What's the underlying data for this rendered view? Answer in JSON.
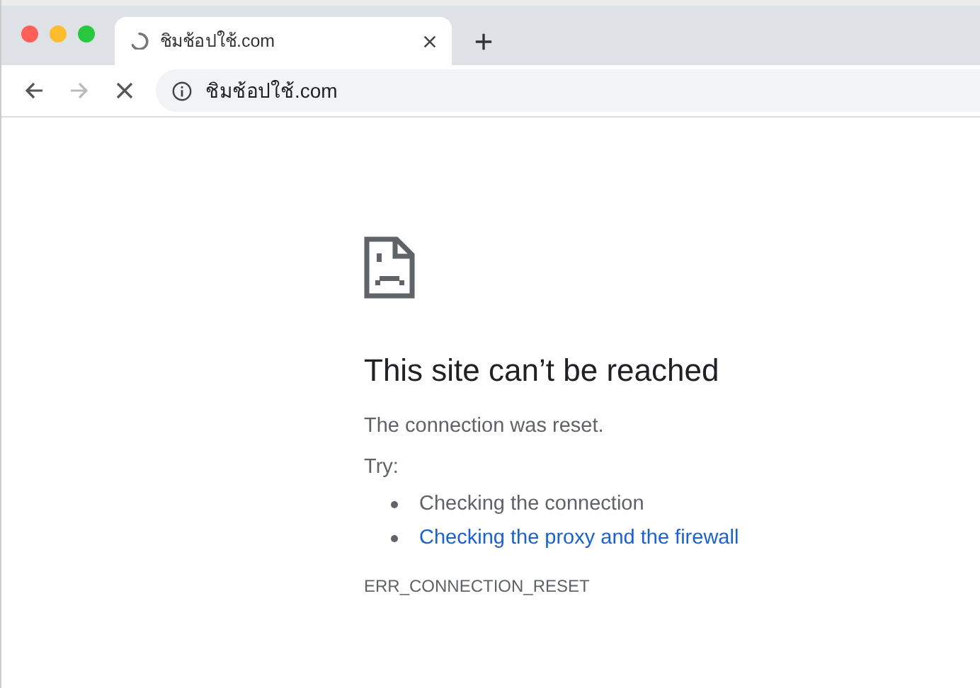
{
  "tab": {
    "title": "ชิมช้อปใช้.com",
    "loading": true
  },
  "toolbar": {
    "back_disabled": false,
    "forward_disabled": true
  },
  "address_bar": {
    "value": "ชิมช้อปใช้.com"
  },
  "error": {
    "title": "This site can’t be reached",
    "message": "The connection was reset.",
    "try_label": "Try:",
    "suggestions": [
      {
        "kind": "text",
        "text": "Checking the connection"
      },
      {
        "kind": "link",
        "text": "Checking the proxy and the firewall"
      }
    ],
    "code": "ERR_CONNECTION_RESET"
  }
}
